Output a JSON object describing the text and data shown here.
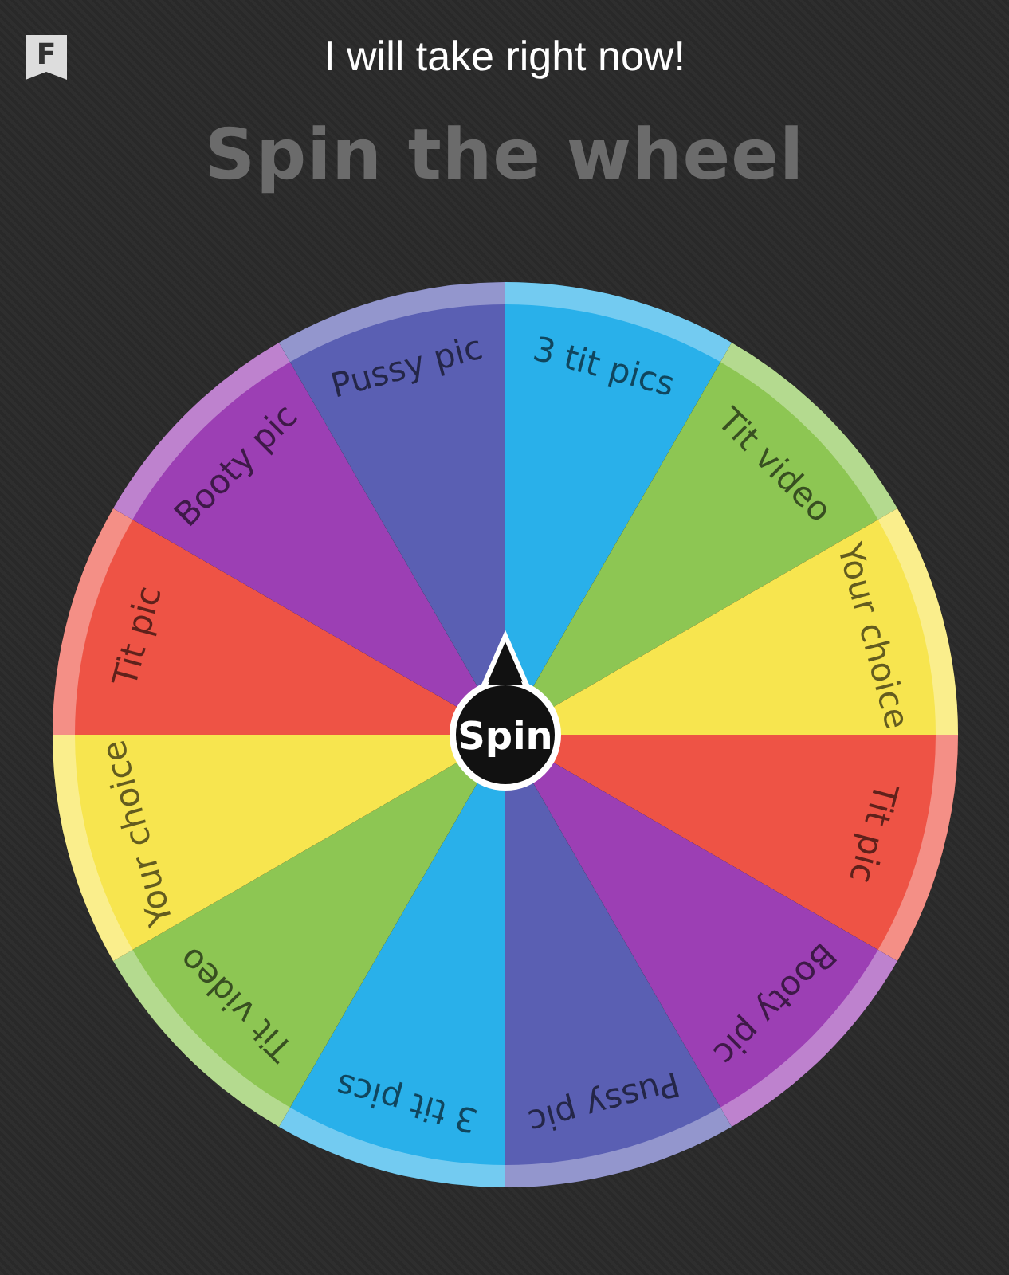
{
  "header": {
    "badge": "F",
    "title": "I will take right now!"
  },
  "heading": "Spin the wheel",
  "wheel": {
    "segments": [
      {
        "label": "3 tit pics",
        "color": "#29b0ea"
      },
      {
        "label": "Tit video",
        "color": "#8dc653"
      },
      {
        "label": "Your choice",
        "color": "#f7e54f"
      },
      {
        "label": "Tit pic",
        "color": "#ee5345"
      },
      {
        "label": "Booty pic",
        "color": "#9c3fb4"
      },
      {
        "label": "Pussy pic",
        "color": "#5a5fb3"
      },
      {
        "label": "3 tit pics",
        "color": "#29b0ea"
      },
      {
        "label": "Tit video",
        "color": "#8dc653"
      },
      {
        "label": "Your choice",
        "color": "#f7e54f"
      },
      {
        "label": "Tit pic",
        "color": "#ee5345"
      },
      {
        "label": "Booty pic",
        "color": "#9c3fb4"
      },
      {
        "label": "Pussy pic",
        "color": "#5a5fb3"
      }
    ],
    "spin_button": "Spin"
  }
}
